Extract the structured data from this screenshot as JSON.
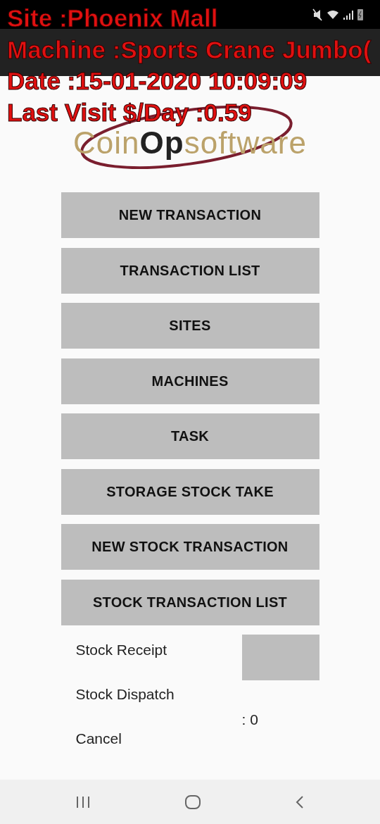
{
  "overlay": {
    "lines": [
      "Site :Phoenix Mall",
      "Machine :Sports Crane Jumbo(",
      "Date :15-01-2020 10:09:09",
      "Last Visit $/Day :0.59"
    ]
  },
  "logo": {
    "parts": [
      "Coin",
      "Op",
      "software"
    ]
  },
  "buttons": [
    "NEW TRANSACTION",
    "TRANSACTION LIST",
    "SITES",
    "MACHINES",
    "TASK",
    "STORAGE STOCK TAKE",
    "NEW STOCK TRANSACTION",
    "STOCK TRANSACTION LIST"
  ],
  "options": [
    "Stock Receipt",
    "Stock Dispatch",
    "Cancel"
  ],
  "count": ": 0"
}
